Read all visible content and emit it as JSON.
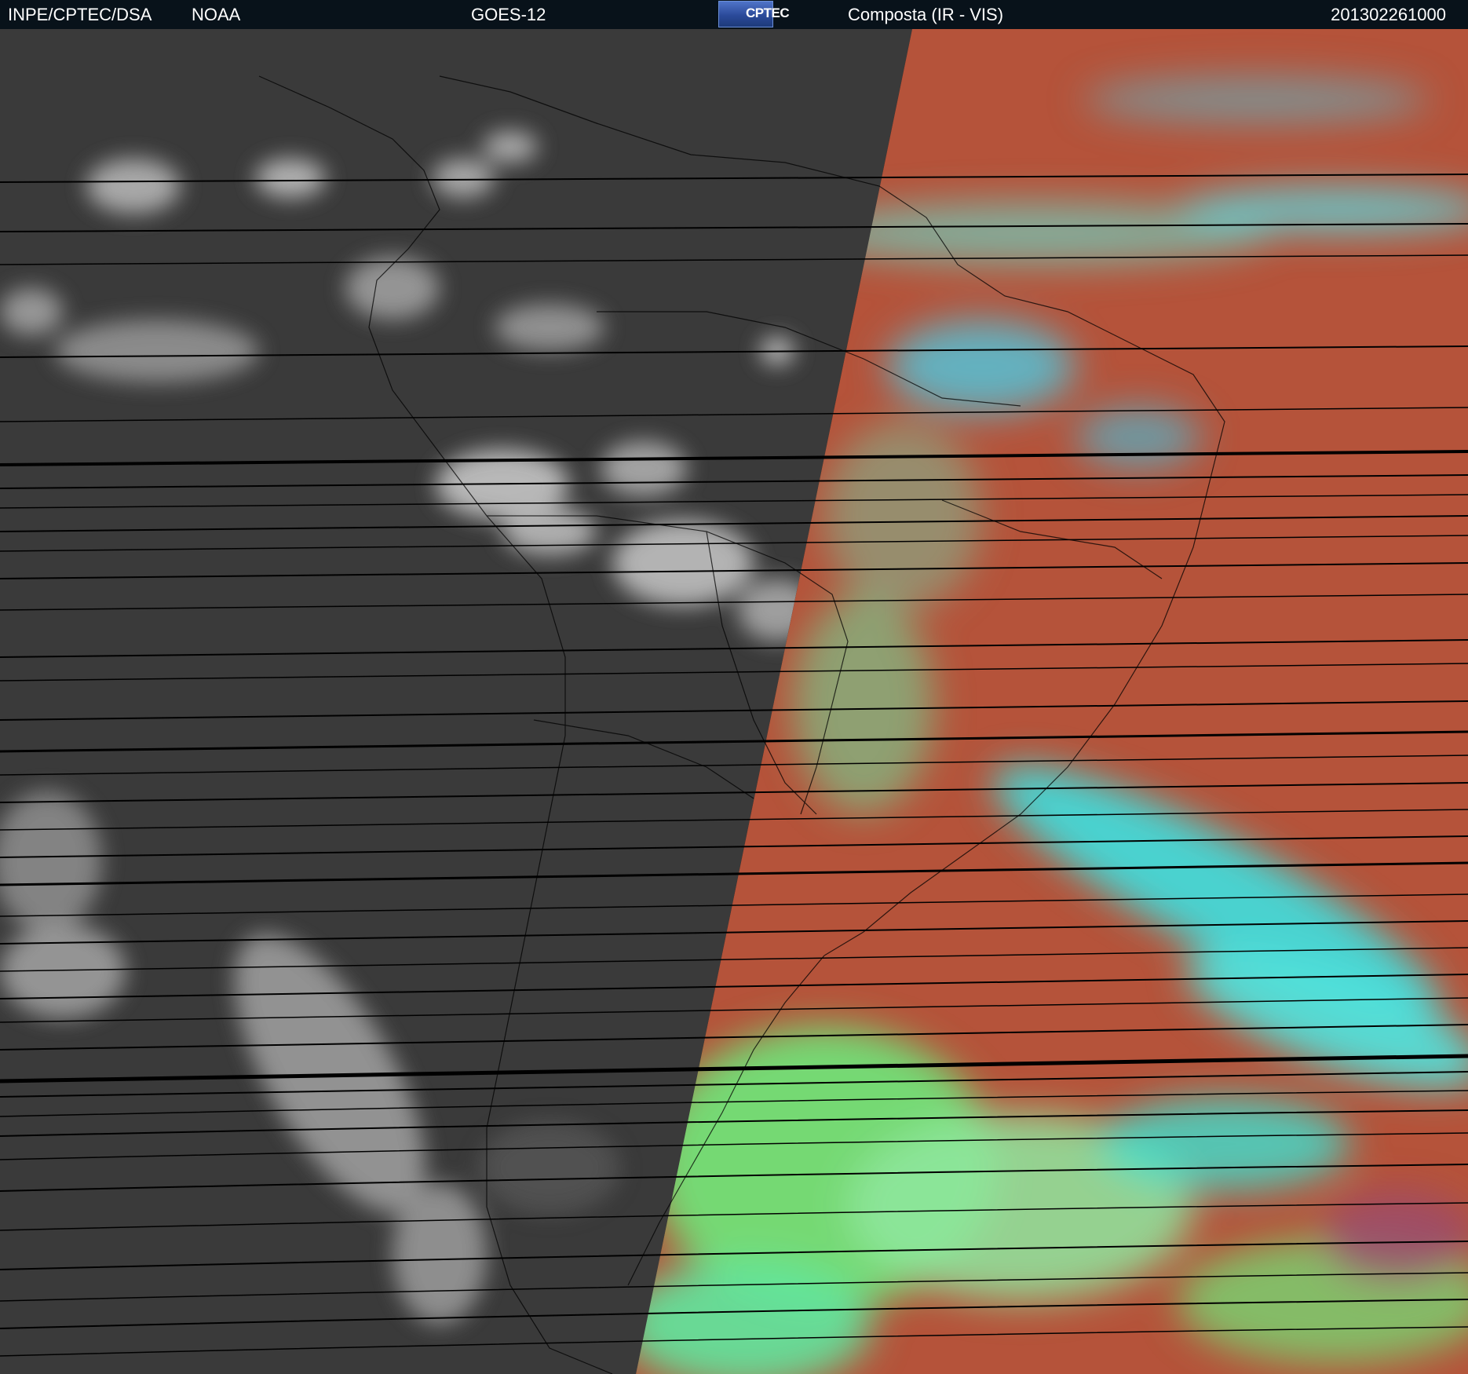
{
  "header": {
    "source": "INPE/CPTEC/DSA",
    "agency": "NOAA",
    "satellite": "GOES-12",
    "logo_text": "CPTEC",
    "product": "Composta (IR - VIS)",
    "timestamp": "201302261000"
  },
  "colors": {
    "header_bg": "#08121a",
    "ir_gray": "#3c3c3c",
    "vis_land_red": "#b5533a",
    "vis_cloud_cyan": "#3fe0e0",
    "vis_green": "#6fe87a",
    "coastline": "#000000"
  }
}
